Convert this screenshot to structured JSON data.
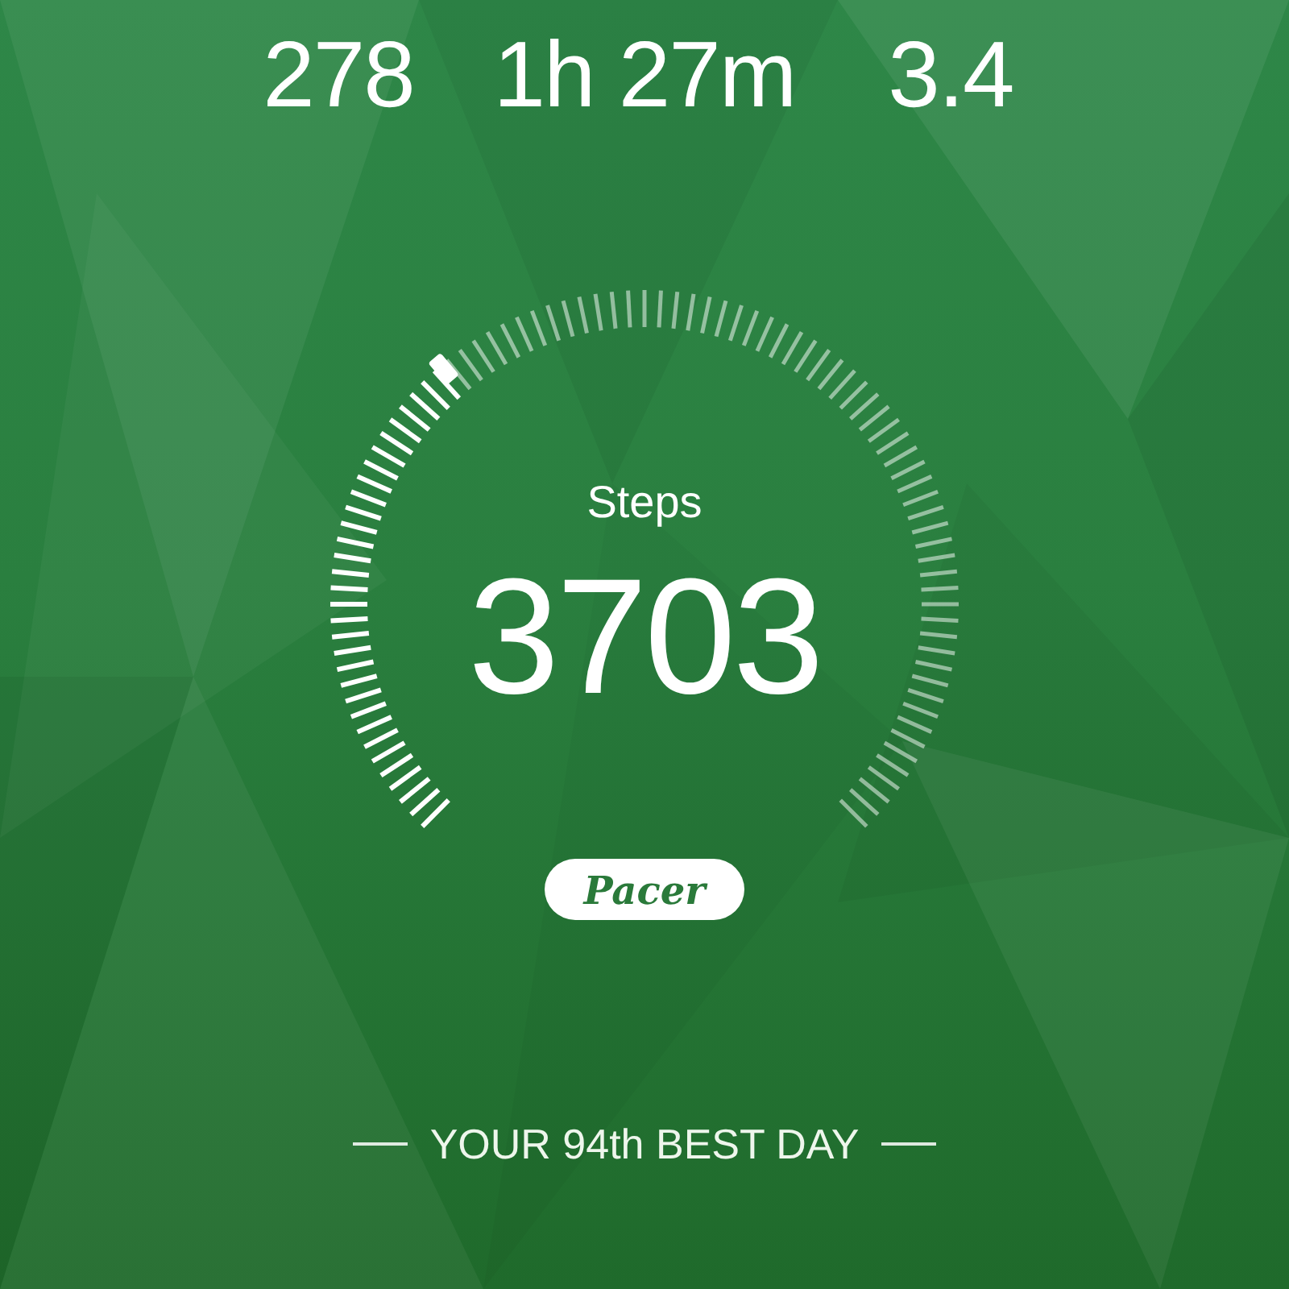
{
  "stats": [
    {
      "value": "278"
    },
    {
      "value": "1h 27m"
    },
    {
      "value": "3.4"
    }
  ],
  "steps": {
    "label": "Steps",
    "value": "3703"
  },
  "brand": {
    "logo": "Pacer"
  },
  "best_day": "YOUR 94th BEST DAY"
}
